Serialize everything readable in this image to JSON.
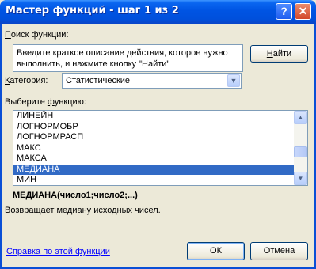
{
  "window": {
    "title": "Мастер функций - шаг 1 из 2",
    "help": "?",
    "close": "✕"
  },
  "search": {
    "label_pre": "П",
    "label_rest": "оиск функции:",
    "description": "Введите краткое описание действия, которое нужно выполнить, и нажмите кнопку \"Найти\"",
    "find_pre": "Н",
    "find_rest": "айти"
  },
  "category": {
    "label_pre": "К",
    "label_rest": "атегория:",
    "value": "Статистические"
  },
  "function_list": {
    "label_pre": "Выберите ",
    "label_u": "ф",
    "label_rest": "ункцию:",
    "items": [
      "ЛИНЕЙН",
      "ЛОГНОРМОБР",
      "ЛОГНОРМРАСП",
      "МАКС",
      "МАКСА",
      "МЕДИАНА",
      "МИН"
    ],
    "selected": "МЕДИАНА"
  },
  "details": {
    "signature": "МЕДИАНА(число1;число2;...)",
    "description": "Возвращает медиану исходных чисел."
  },
  "footer": {
    "help_link": "Справка по этой функции",
    "ok": "ОК",
    "cancel": "Отмена"
  },
  "colors": {
    "titlebar": "#0054e3",
    "selection": "#316ac5",
    "link": "#0000ff",
    "face": "#ece9d8"
  }
}
